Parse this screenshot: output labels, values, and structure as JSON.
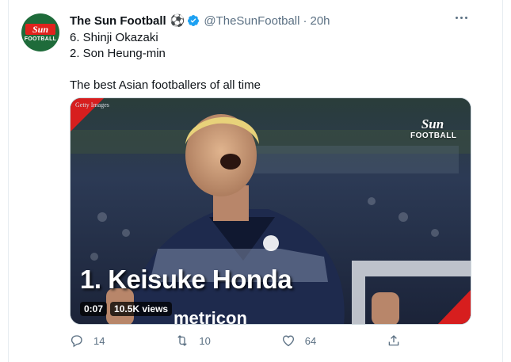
{
  "tweet": {
    "display_name": "The Sun Football",
    "name_emoji": "⚽",
    "handle": "@TheSunFootball",
    "separator": "·",
    "time": "20h",
    "lines": [
      "6. Shinji Okazaki",
      "2. Son Heung-min",
      "",
      "The best Asian footballers of all time"
    ]
  },
  "avatar": {
    "badge": "Sun",
    "subtext": "FOOTBALL"
  },
  "media": {
    "credit": "Getty Images",
    "watermark_top": "Sun",
    "watermark_bottom": "FOOTBALL",
    "caption": "1. Keisuke Honda",
    "shirt_sponsor": "metricon",
    "duration": "0:07",
    "views": "10.5K views"
  },
  "actions": {
    "reply_count": "14",
    "retweet_count": "10",
    "like_count": "64"
  },
  "colors": {
    "text": "#0f1419",
    "secondary": "#5b7083",
    "verified": "#1da1f2",
    "sun_red": "#e0231d"
  }
}
